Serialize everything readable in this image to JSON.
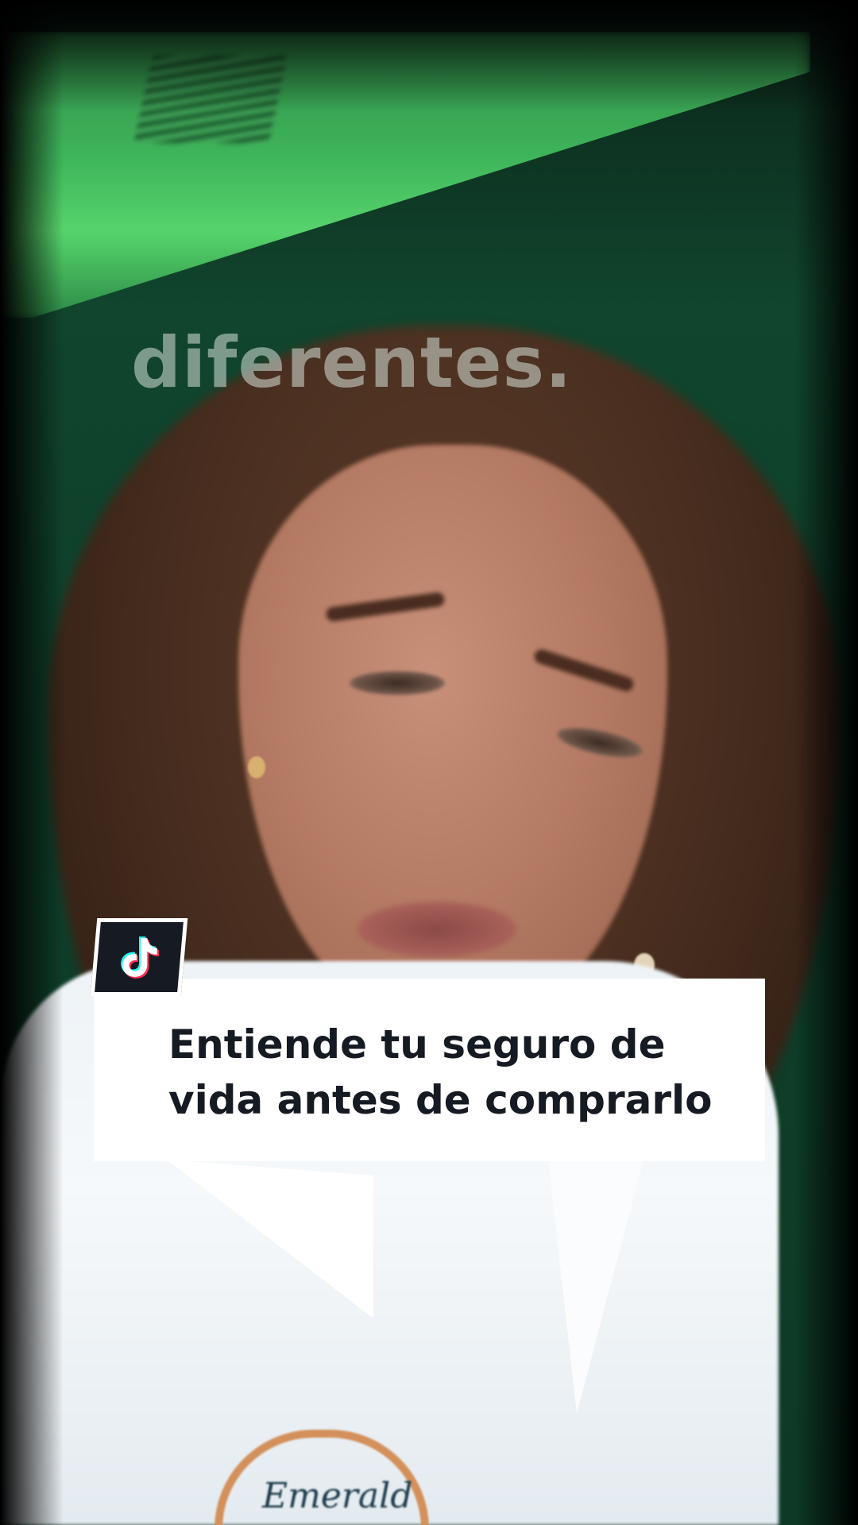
{
  "video": {
    "caption_word": "diferentes.",
    "shirt_logo_text": "Emerald"
  },
  "title_card": {
    "badge_icon": "tiktok-logo-icon",
    "line_1": "Entiende tu seguro de",
    "line_2": "vida antes de comprarlo"
  },
  "colors": {
    "wall_green": "#0d3a26",
    "ceiling_green": "#56d46c",
    "card_background": "#ffffff",
    "card_text": "#161a22",
    "badge_background": "#161a22"
  }
}
